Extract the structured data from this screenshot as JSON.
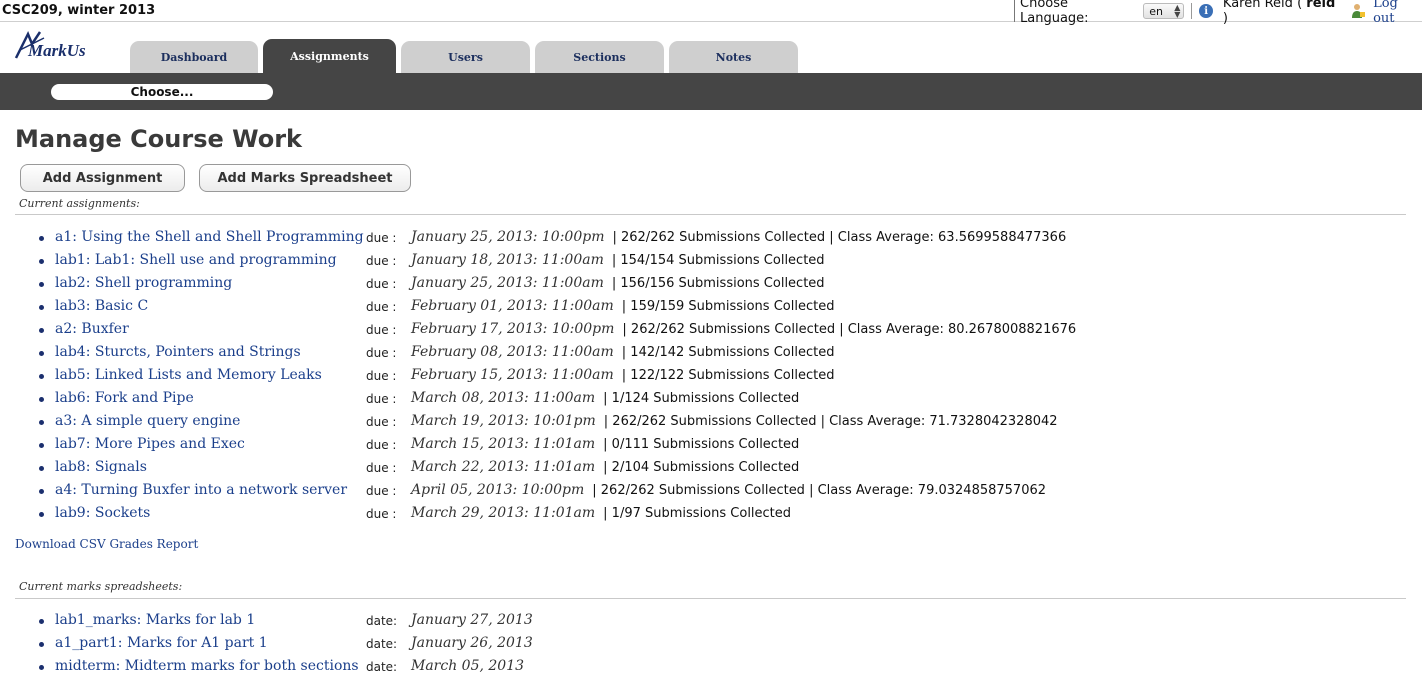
{
  "topbar": {
    "course": "CSC209, winter 2013",
    "choose_language_label": "Choose Language:",
    "language_value": "en",
    "user_name": "Karen Reid",
    "user_open": "(",
    "user_id": "reid",
    "user_close": ")",
    "logout": "Log out"
  },
  "logo": {
    "text": "MarkUs"
  },
  "tabs": [
    {
      "label": "Dashboard",
      "active": false
    },
    {
      "label": "Assignments",
      "active": true
    },
    {
      "label": "Users",
      "active": false
    },
    {
      "label": "Sections",
      "active": false
    },
    {
      "label": "Notes",
      "active": false
    }
  ],
  "subnav": {
    "choose": "Choose..."
  },
  "page": {
    "title": "Manage Course Work",
    "add_assignment": "Add Assignment",
    "add_marks_spreadsheet": "Add Marks Spreadsheet",
    "current_assignments_label": "Current assignments:",
    "current_spreadsheets_label": "Current marks spreadsheets:",
    "download_csv": "Download CSV Grades Report"
  },
  "assignments": [
    {
      "name": "a1: Using the Shell and Shell Programming",
      "due_label": "due :",
      "due": "January 25, 2013: 10:00pm",
      "stats": "| 262/262 Submissions Collected | Class Average: 63.5699588477366"
    },
    {
      "name": "lab1: Lab1: Shell use and programming",
      "due_label": "due :",
      "due": "January 18, 2013: 11:00am",
      "stats": "| 154/154 Submissions Collected"
    },
    {
      "name": "lab2: Shell programming",
      "due_label": "due :",
      "due": "January 25, 2013: 11:00am",
      "stats": "| 156/156 Submissions Collected"
    },
    {
      "name": "lab3: Basic C",
      "due_label": "due :",
      "due": "February 01, 2013: 11:00am",
      "stats": "| 159/159 Submissions Collected"
    },
    {
      "name": "a2: Buxfer",
      "due_label": "due :",
      "due": "February 17, 2013: 10:00pm",
      "stats": "| 262/262 Submissions Collected | Class Average: 80.2678008821676"
    },
    {
      "name": "lab4: Sturcts, Pointers and Strings",
      "due_label": "due :",
      "due": "February 08, 2013: 11:00am",
      "stats": "| 142/142 Submissions Collected"
    },
    {
      "name": "lab5: Linked Lists and Memory Leaks",
      "due_label": "due :",
      "due": "February 15, 2013: 11:00am",
      "stats": "| 122/122 Submissions Collected"
    },
    {
      "name": "lab6: Fork and Pipe",
      "due_label": "due :",
      "due": "March 08, 2013: 11:00am",
      "stats": "| 1/124 Submissions Collected"
    },
    {
      "name": "a3: A simple query engine",
      "due_label": "due :",
      "due": "March 19, 2013: 10:01pm",
      "stats": "| 262/262 Submissions Collected | Class Average: 71.7328042328042"
    },
    {
      "name": "lab7: More Pipes and Exec",
      "due_label": "due :",
      "due": "March 15, 2013: 11:01am",
      "stats": "| 0/111 Submissions Collected"
    },
    {
      "name": "lab8: Signals",
      "due_label": "due :",
      "due": "March 22, 2013: 11:01am",
      "stats": "| 2/104 Submissions Collected"
    },
    {
      "name": "a4: Turning Buxfer into a network server",
      "due_label": "due :",
      "due": "April 05, 2013: 10:00pm",
      "stats": "| 262/262 Submissions Collected | Class Average: 79.0324858757062"
    },
    {
      "name": "lab9: Sockets",
      "due_label": "due :",
      "due": "March 29, 2013: 11:01am",
      "stats": "| 1/97 Submissions Collected"
    }
  ],
  "spreadsheets": [
    {
      "name": "lab1_marks: Marks for lab 1",
      "date_label": "date:",
      "date": "January 27, 2013"
    },
    {
      "name": "a1_part1: Marks for A1 part 1",
      "date_label": "date:",
      "date": "January 26, 2013"
    },
    {
      "name": "midterm: Midterm marks for both sections",
      "date_label": "date:",
      "date": "March 05, 2013"
    }
  ]
}
